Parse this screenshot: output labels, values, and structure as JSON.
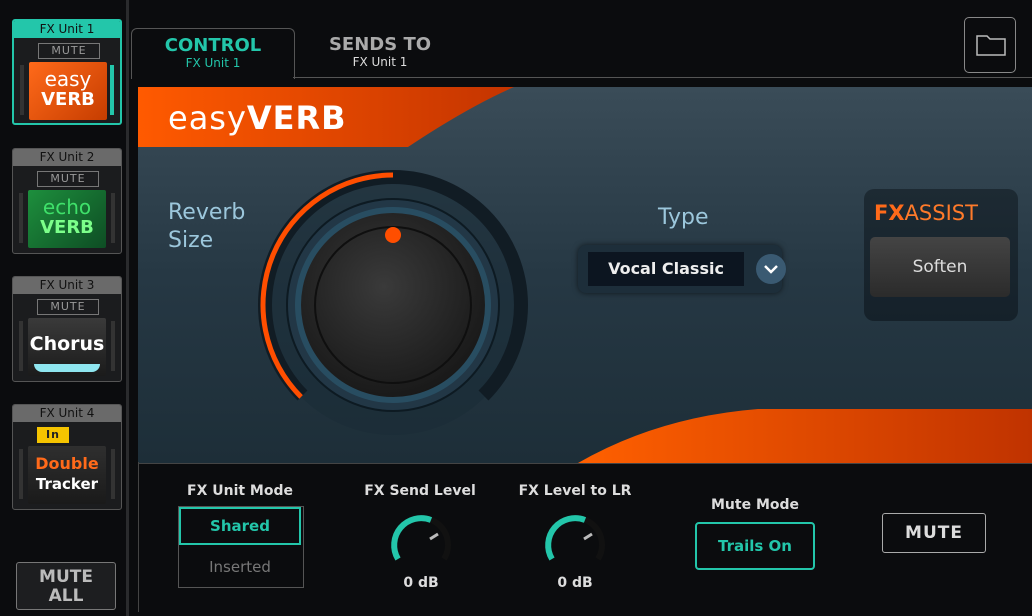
{
  "sidebar": {
    "units": [
      {
        "title": "FX Unit 1",
        "mute": "MUTE",
        "art_line1": "easy",
        "art_line2": "VERB",
        "state": "active"
      },
      {
        "title": "FX Unit 2",
        "mute": "MUTE",
        "art_line1": "echo",
        "art_line2": "VERB",
        "state": "normal"
      },
      {
        "title": "FX Unit 3",
        "mute": "MUTE",
        "art_line1": "Chorus",
        "art_line2": "",
        "state": "normal"
      },
      {
        "title": "FX Unit 4",
        "mute": "In",
        "art_line1": "Double",
        "art_line2": "Tracker",
        "state": "inserted"
      }
    ],
    "mute_all_line1": "MUTE",
    "mute_all_line2": "ALL"
  },
  "tabs": {
    "control": {
      "label": "CONTROL",
      "sub": "FX Unit 1"
    },
    "sends": {
      "label": "SENDS TO",
      "sub": "FX Unit 1"
    }
  },
  "panel": {
    "brand_light": "easy",
    "brand_bold": "VERB",
    "reverb_label_1": "Reverb",
    "reverb_label_2": "Size",
    "reverb_size_fraction": 0.5,
    "type_label": "Type",
    "type_value": "Vocal Classic",
    "fxassist_bold": "FX",
    "fxassist_rest": "ASSIST",
    "fxassist_button": "Soften"
  },
  "bottom": {
    "unit_mode_label": "FX Unit Mode",
    "unit_mode_shared": "Shared",
    "unit_mode_inserted": "Inserted",
    "send_level_label": "FX Send Level",
    "send_level_value": "0 dB",
    "level_lr_label": "FX Level to LR",
    "level_lr_value": "0 dB",
    "mute_mode_label": "Mute Mode",
    "mute_mode_value": "Trails On",
    "mute_button": "MUTE"
  },
  "colors": {
    "accent": "#23c6aa",
    "orange": "#ff5a1a",
    "in_badge": "#f5c400"
  }
}
